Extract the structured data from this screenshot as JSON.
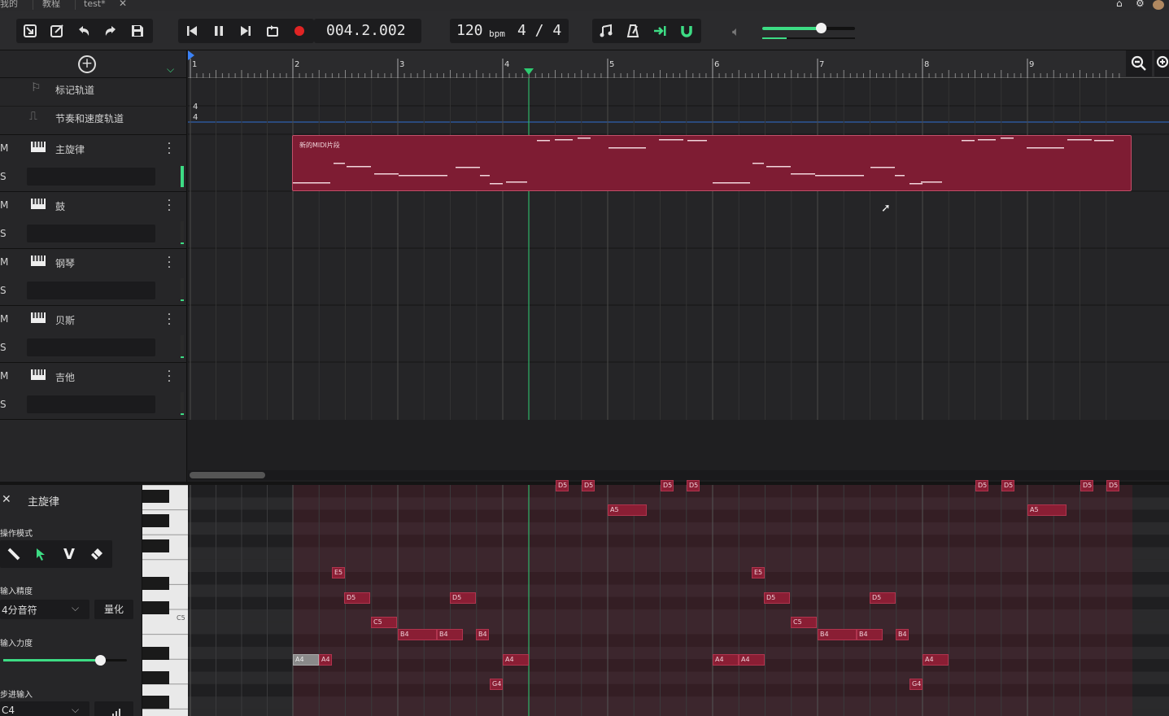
{
  "tabs": [
    {
      "label": "我的"
    },
    {
      "label": "教程"
    },
    {
      "label": "test*"
    }
  ],
  "transport": {
    "position": "004.2.002",
    "tempo": "120",
    "tempo_unit": "bpm",
    "time_signature": "4 / 4",
    "volume_level": 0.63
  },
  "ruler": {
    "bars": [
      "1",
      "2",
      "3",
      "4",
      "5",
      "6",
      "7",
      "8",
      "9"
    ]
  },
  "tracks": {
    "marker_track": "标记轨道",
    "tempo_track": "节奏和速度轨道",
    "tempo_sig_top": "4",
    "tempo_sig_bottom": "4",
    "instruments": [
      {
        "name": "主旋律",
        "m": "M",
        "s": "S"
      },
      {
        "name": "鼓",
        "m": "M",
        "s": "S"
      },
      {
        "name": "钢琴",
        "m": "M",
        "s": "S"
      },
      {
        "name": "贝斯",
        "m": "M",
        "s": "S"
      },
      {
        "name": "吉他",
        "m": "M",
        "s": "S"
      }
    ]
  },
  "clip": {
    "label": "新的MIDI片段"
  },
  "piano_roll": {
    "track_name": "主旋律",
    "mode_label": "操作模式",
    "precision_label": "输入精度",
    "precision_value": "4分音符",
    "quantize_label": "量化",
    "velocity_label": "输入力度",
    "velocity_level": 0.78,
    "step_input_label": "步进输入",
    "step_input_value": "C4",
    "key_c5_label": "C5",
    "notes": [
      {
        "pitch": "D5"
      },
      {
        "pitch": "D5"
      },
      {
        "pitch": "D5"
      },
      {
        "pitch": "D5"
      },
      {
        "pitch": "A5"
      },
      {
        "pitch": "E5"
      },
      {
        "pitch": "D5"
      },
      {
        "pitch": "D5"
      },
      {
        "pitch": "C5"
      },
      {
        "pitch": "B4"
      },
      {
        "pitch": "B4"
      },
      {
        "pitch": "B4"
      },
      {
        "pitch": "A4"
      },
      {
        "pitch": "A4"
      },
      {
        "pitch": "A4"
      },
      {
        "pitch": "G4"
      },
      {
        "pitch": "D5"
      },
      {
        "pitch": "D5"
      },
      {
        "pitch": "D5"
      },
      {
        "pitch": "D5"
      },
      {
        "pitch": "A5"
      },
      {
        "pitch": "E5"
      },
      {
        "pitch": "D5"
      },
      {
        "pitch": "D5"
      },
      {
        "pitch": "C5"
      },
      {
        "pitch": "B4"
      },
      {
        "pitch": "B4"
      },
      {
        "pitch": "B4"
      },
      {
        "pitch": "A4"
      },
      {
        "pitch": "A4"
      },
      {
        "pitch": "A4"
      },
      {
        "pitch": "G4"
      }
    ]
  },
  "colors": {
    "clip": "#7e1c33",
    "clip_border": "#c2506a",
    "playhead": "#2ecc71",
    "accent_green": "#3ddc84"
  }
}
